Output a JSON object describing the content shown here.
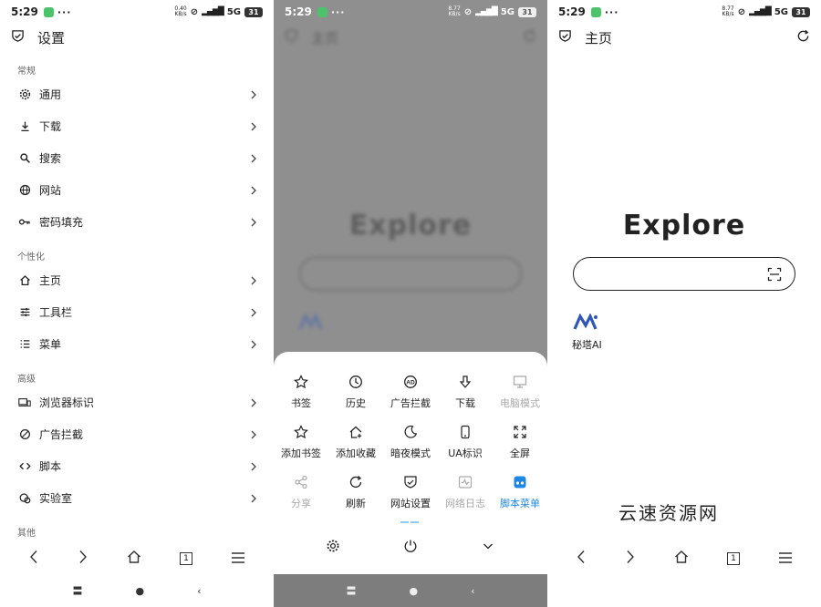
{
  "status": {
    "time": "5:29",
    "dots": "···",
    "net": "5G",
    "battery": "31",
    "panel1_speed_value": "0.40",
    "panel2_speed_value": "8.77",
    "panel3_speed_value": "8.77",
    "speed_unit": "KB/s"
  },
  "settings": {
    "title": "设置",
    "sections": {
      "general": "常规",
      "personal": "个性化",
      "advanced": "高级",
      "other": "其他"
    },
    "items": [
      {
        "label": "通用",
        "icon": "gear-icon"
      },
      {
        "label": "下载",
        "icon": "download-icon"
      },
      {
        "label": "搜索",
        "icon": "search-icon"
      },
      {
        "label": "网站",
        "icon": "globe-icon"
      },
      {
        "label": "密码填充",
        "icon": "key-icon"
      },
      {
        "label": "主页",
        "icon": "home-icon"
      },
      {
        "label": "工具栏",
        "icon": "sliders-icon"
      },
      {
        "label": "菜单",
        "icon": "list-icon"
      },
      {
        "label": "浏览器标识",
        "icon": "devices-icon"
      },
      {
        "label": "广告拦截",
        "icon": "block-icon"
      },
      {
        "label": "脚本",
        "icon": "code-icon"
      },
      {
        "label": "实验室",
        "icon": "lab-icon"
      }
    ]
  },
  "home": {
    "title": "主页",
    "explore": "Explore",
    "site_label": "秘塔AI",
    "tab_count": "1"
  },
  "menu": {
    "items": [
      {
        "label": "书签",
        "icon": "star-icon"
      },
      {
        "label": "历史",
        "icon": "clock-icon"
      },
      {
        "label": "广告拦截",
        "icon": "ad-block-icon"
      },
      {
        "label": "下载",
        "icon": "download-arrow-icon"
      },
      {
        "label": "电脑模式",
        "icon": "monitor-icon"
      },
      {
        "label": "添加书签",
        "icon": "star-add-icon"
      },
      {
        "label": "添加收藏",
        "icon": "home-add-icon"
      },
      {
        "label": "暗夜模式",
        "icon": "moon-icon"
      },
      {
        "label": "UA标识",
        "icon": "phone-icon"
      },
      {
        "label": "全屏",
        "icon": "fullscreen-icon"
      },
      {
        "label": "分享",
        "icon": "share-icon"
      },
      {
        "label": "刷新",
        "icon": "refresh-icon"
      },
      {
        "label": "网站设置",
        "icon": "shield-icon"
      },
      {
        "label": "网络日志",
        "icon": "pulse-icon"
      },
      {
        "label": "脚本菜单",
        "icon": "script-menu-icon"
      }
    ]
  },
  "watermark": "云速资源网",
  "colors": {
    "accent": "#1e88e5",
    "logo": "#2f57b8",
    "dim_overlay": "#8f8f8f"
  }
}
